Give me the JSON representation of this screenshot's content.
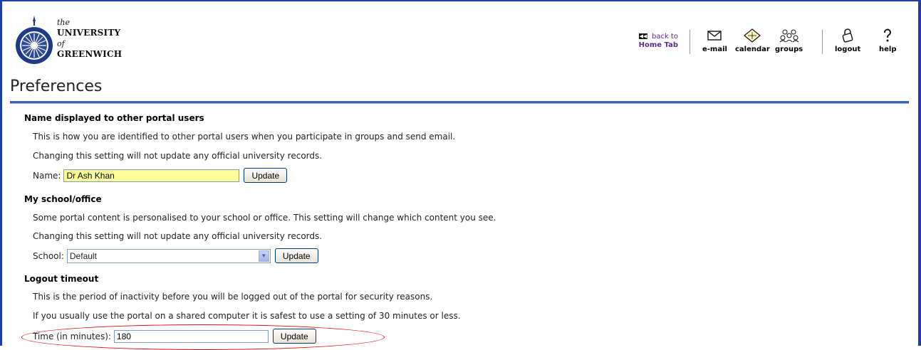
{
  "header": {
    "logo_text_the": "the",
    "logo_text_university": "UNIVERSITY",
    "logo_text_of": "of",
    "logo_text_greenwich": "GREENWICH",
    "page_title": "Preferences"
  },
  "toolbar": {
    "back_line1": "back to",
    "back_line2": "Home Tab",
    "email": "e-mail",
    "calendar": "calendar",
    "groups": "groups",
    "logout": "logout",
    "help": "help"
  },
  "name_section": {
    "heading": "Name displayed to other portal users",
    "desc1": "This is how you are identified to other portal users when you participate in groups and send email.",
    "desc2": "Changing this setting will not update any official university records.",
    "label": "Name:",
    "value": "Dr Ash Khan",
    "button": "Update"
  },
  "school_section": {
    "heading": "My school/office",
    "desc1": "Some portal content is personalised to your school or office. This setting will change which content you see.",
    "desc2": "Changing this setting will not update any official university records.",
    "label": "School:",
    "selected": "Default",
    "button": "Update"
  },
  "timeout_section": {
    "heading": "Logout timeout",
    "desc1": "This is the period of inactivity before you will be logged out of the portal for security reasons.",
    "desc2": "If you usually use the portal on a shared computer it is safest to use a setting of 30 minutes or less.",
    "label": "Time (in minutes):",
    "value": "180",
    "button": "Update"
  },
  "colors": {
    "frame_blue": "#1c3fa8",
    "name_field_bg": "#ffff99",
    "highlight_red": "#dd1111",
    "link_purple": "#5b2b8a"
  }
}
